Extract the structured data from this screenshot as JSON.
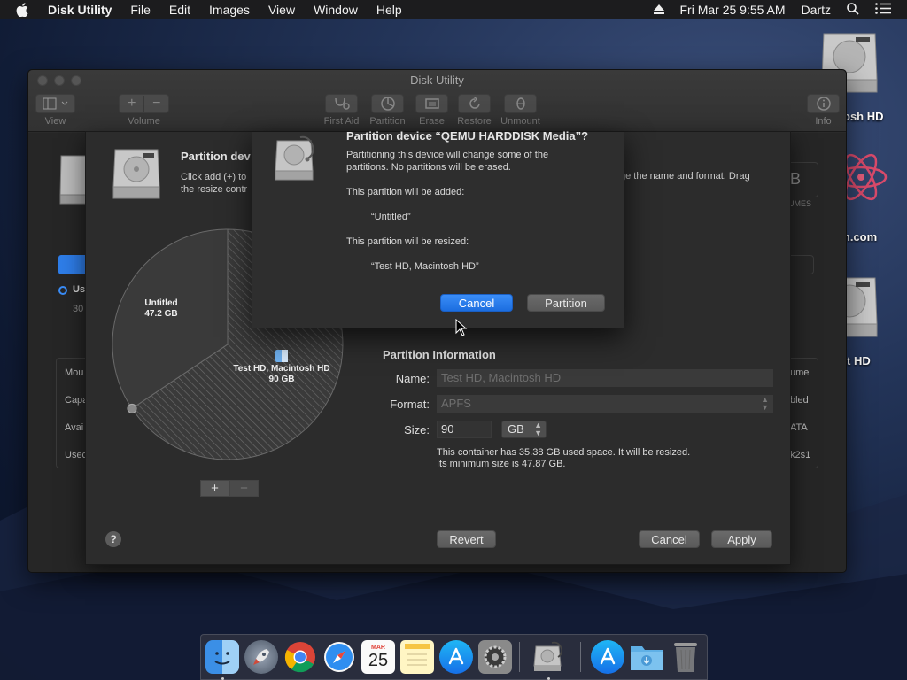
{
  "menubar": {
    "app_name": "Disk Utility",
    "items": [
      "File",
      "Edit",
      "Images",
      "View",
      "Window",
      "Help"
    ],
    "clock": "Fri Mar 25  9:55 AM",
    "user": "Dartz"
  },
  "desktop": {
    "icons": [
      {
        "label": "osh HD"
      },
      {
        "label": "gon.com"
      },
      {
        "label": "t HD"
      }
    ]
  },
  "window": {
    "title": "Disk Utility",
    "toolbar": {
      "view": "View",
      "volume": "Volume",
      "first_aid": "First Aid",
      "partition": "Partition",
      "erase": "Erase",
      "restore": "Restore",
      "unmount": "Unmount",
      "info": "Info"
    },
    "background": {
      "size_fragment": "B",
      "volumes_fragment": "UMES",
      "usage_fragment": "Us",
      "usage_value_fragment": "30",
      "left_rows": [
        "Mou",
        "Capa",
        "Avai",
        "Usec"
      ],
      "right_rows": [
        "ume",
        "bled",
        "ATA",
        "k2s1"
      ]
    }
  },
  "sheet": {
    "title": "Partition dev",
    "description_line1": "Click add (+) to",
    "description_line2": "the resize contr",
    "description_right": "ge the name and format. Drag",
    "pie": {
      "slices": [
        {
          "name": "Untitled",
          "size": "47.2 GB",
          "gb": 47.2
        },
        {
          "name": "Test HD, Macintosh HD",
          "size": "90 GB",
          "gb": 90
        }
      ]
    },
    "add_label": "+",
    "remove_label": "−",
    "info": {
      "heading": "Partition Information",
      "name_label": "Name:",
      "name_value": "Test HD, Macintosh HD",
      "format_label": "Format:",
      "format_value": "APFS",
      "size_label": "Size:",
      "size_value": "90",
      "size_unit": "GB",
      "note_line1": "This container has 35.38 GB used space. It will be resized.",
      "note_line2": "Its minimum size is 47.87 GB."
    },
    "help_label": "?",
    "revert_label": "Revert",
    "cancel_label": "Cancel",
    "apply_label": "Apply"
  },
  "alert": {
    "title": "Partition device “QEMU HARDDISK Media”?",
    "line1": "Partitioning this device will change some of the",
    "line2": "partitions. No partitions will be erased.",
    "added_heading": "This partition will be added:",
    "added_item": "“Untitled”",
    "resized_heading": "This partition will be resized:",
    "resized_item": "“Test HD, Macintosh HD”",
    "cancel_label": "Cancel",
    "partition_label": "Partition"
  },
  "dock": {
    "calendar_month": "MAR",
    "calendar_day": "25"
  },
  "colors": {
    "accent": "#1c6ee0",
    "window_bg": "#2a2a2a"
  }
}
